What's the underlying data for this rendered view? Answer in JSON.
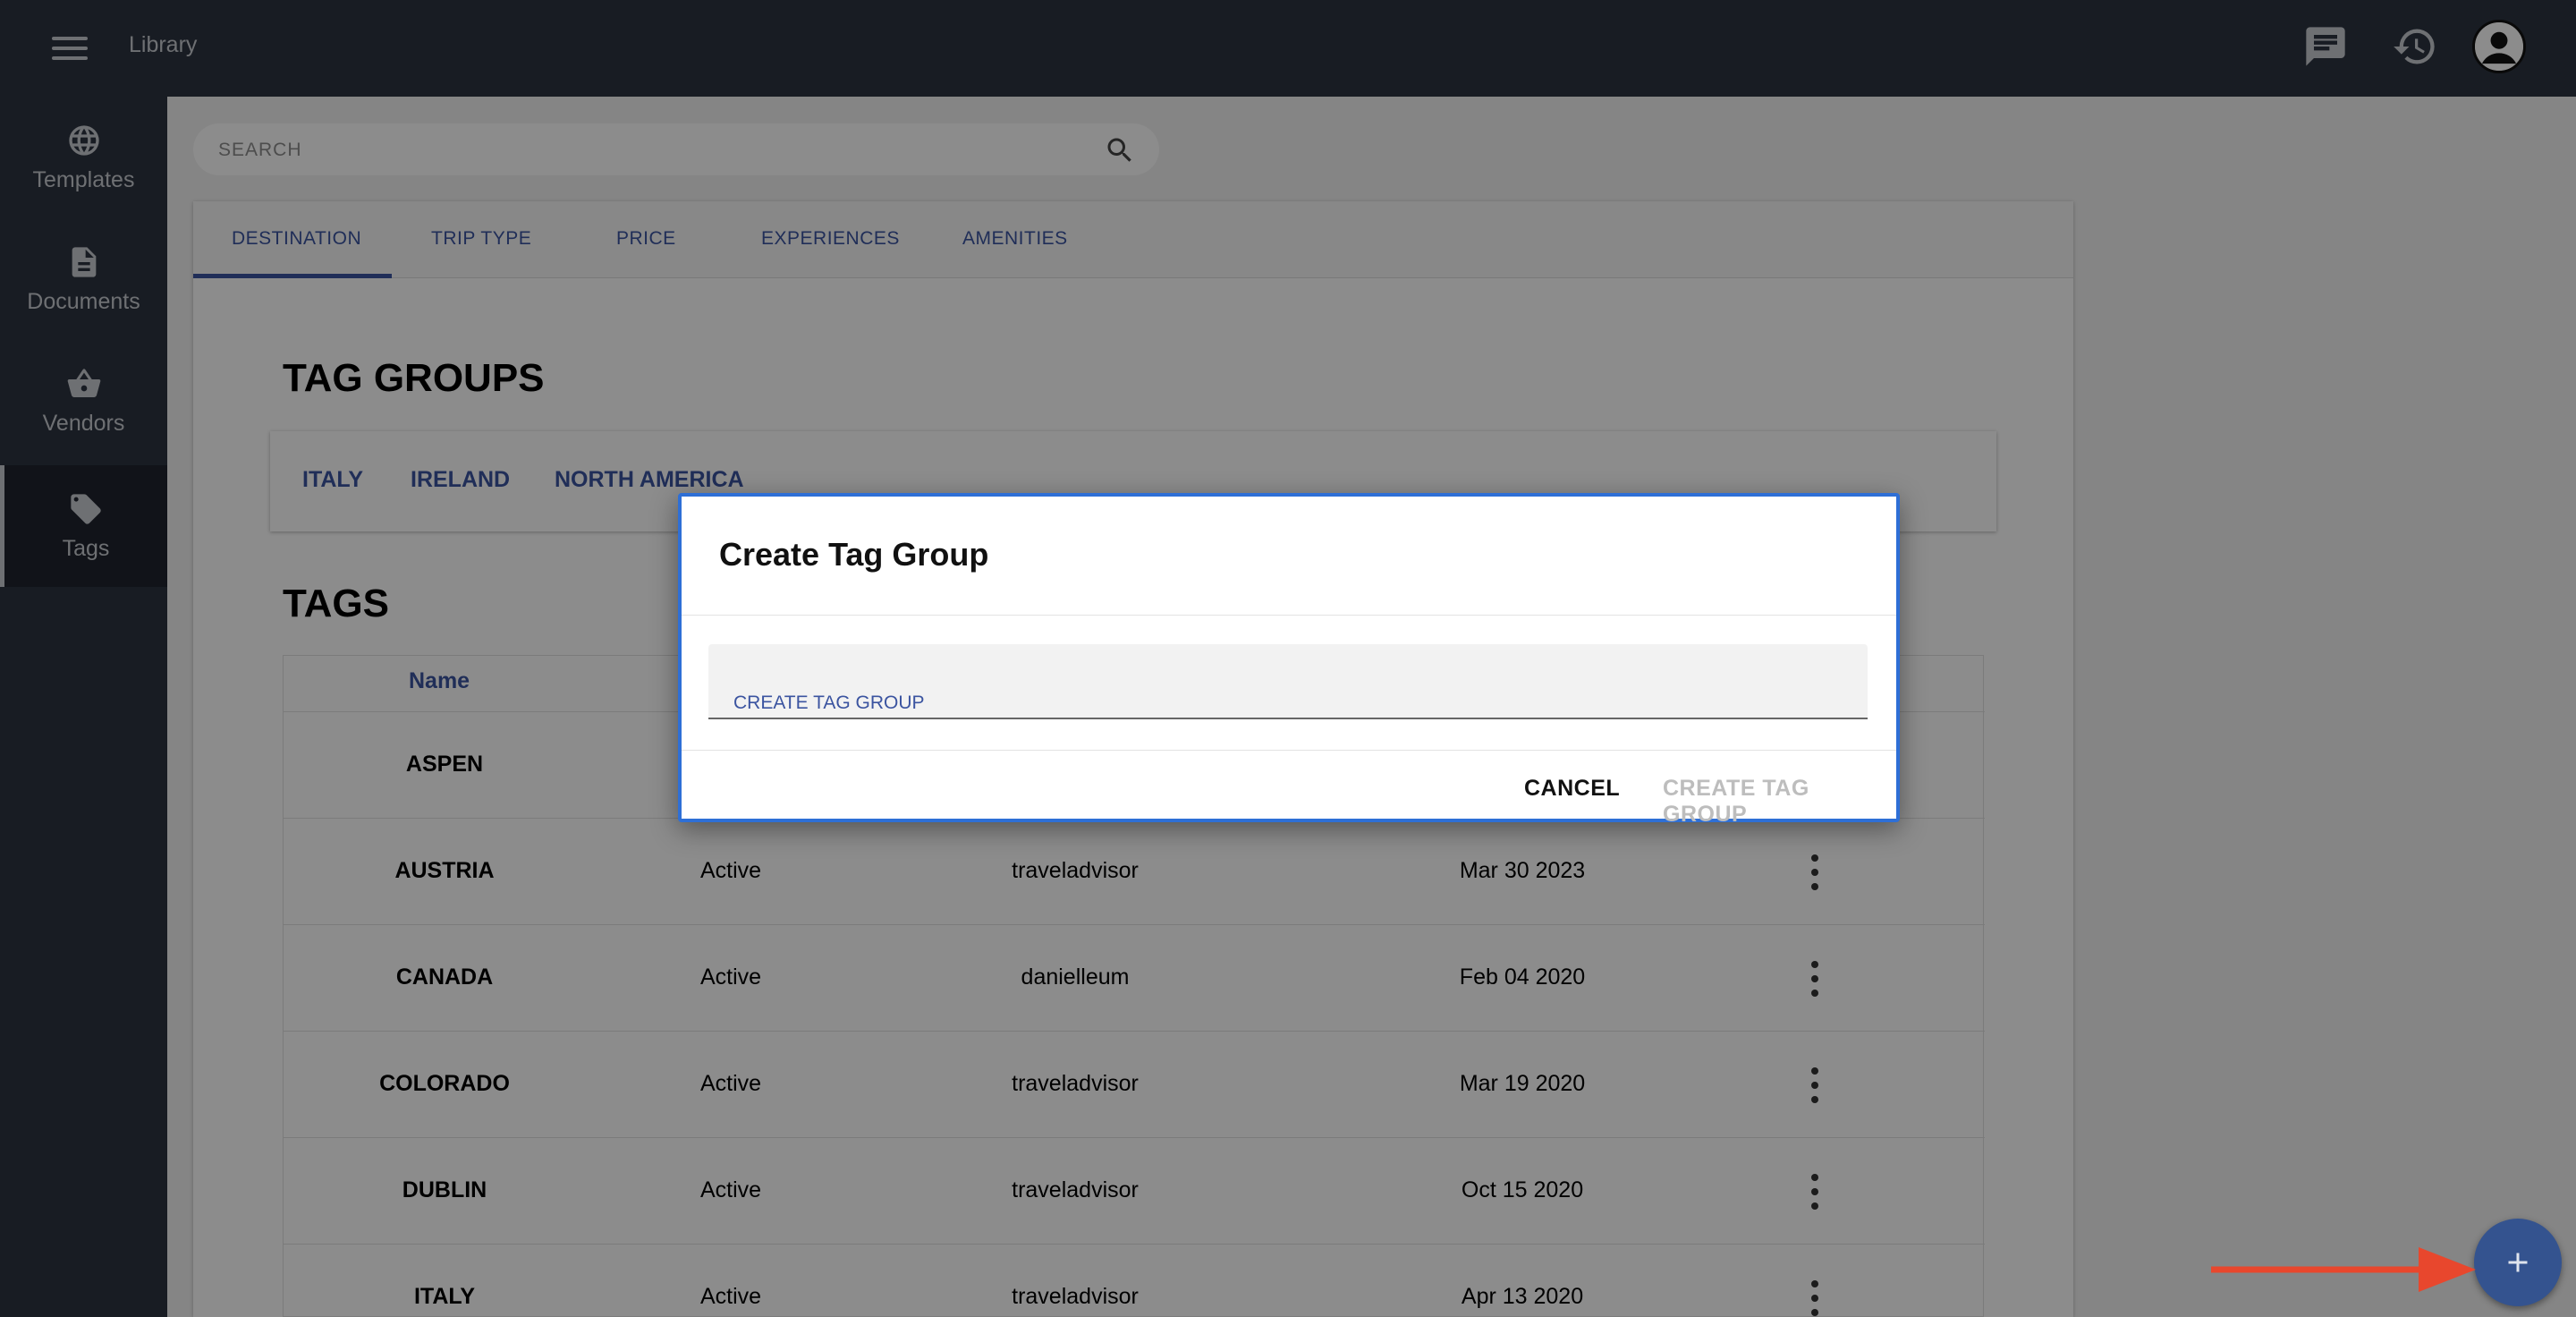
{
  "topbar": {
    "title": "Library",
    "icons": [
      "menu-icon",
      "chat-icon",
      "history-icon",
      "account-icon"
    ]
  },
  "sidebar": {
    "items": [
      {
        "label": "Templates",
        "icon": "globe-icon"
      },
      {
        "label": "Documents",
        "icon": "document-icon"
      },
      {
        "label": "Vendors",
        "icon": "basket-icon"
      },
      {
        "label": "Tags",
        "icon": "tag-icon",
        "active": true
      }
    ]
  },
  "search": {
    "placeholder": "SEARCH"
  },
  "tabs": [
    "DESTINATION",
    "TRIP TYPE",
    "PRICE",
    "EXPERIENCES",
    "AMENITIES"
  ],
  "tag_groups": {
    "heading": "TAG GROUPS",
    "items": [
      "ITALY",
      "IRELAND",
      "NORTH AMERICA"
    ]
  },
  "tags": {
    "heading": "TAGS",
    "columns": [
      "Name"
    ],
    "rows": [
      {
        "name": "ASPEN",
        "status": "",
        "user": "",
        "date": ""
      },
      {
        "name": "AUSTRIA",
        "status": "Active",
        "user": "traveladvisor",
        "date": "Mar 30 2023"
      },
      {
        "name": "CANADA",
        "status": "Active",
        "user": "danielleum",
        "date": "Feb 04 2020"
      },
      {
        "name": "COLORADO",
        "status": "Active",
        "user": "traveladvisor",
        "date": "Mar 19 2020"
      },
      {
        "name": "DUBLIN",
        "status": "Active",
        "user": "traveladvisor",
        "date": "Oct 15 2020"
      },
      {
        "name": "ITALY",
        "status": "Active",
        "user": "traveladvisor",
        "date": "Apr 13 2020"
      }
    ]
  },
  "dialog": {
    "title": "Create Tag Group",
    "field_label": "CREATE TAG GROUP",
    "field_value": "",
    "cancel_label": "CANCEL",
    "submit_label": "CREATE TAG GROUP"
  },
  "fab": {
    "icon": "plus-icon"
  },
  "colors": {
    "nav_bg": "#2c3340",
    "accent": "#3b54a0",
    "dialog_border": "#2e6fd6",
    "fab": "#34538f",
    "annotation_arrow": "#e8472d"
  }
}
